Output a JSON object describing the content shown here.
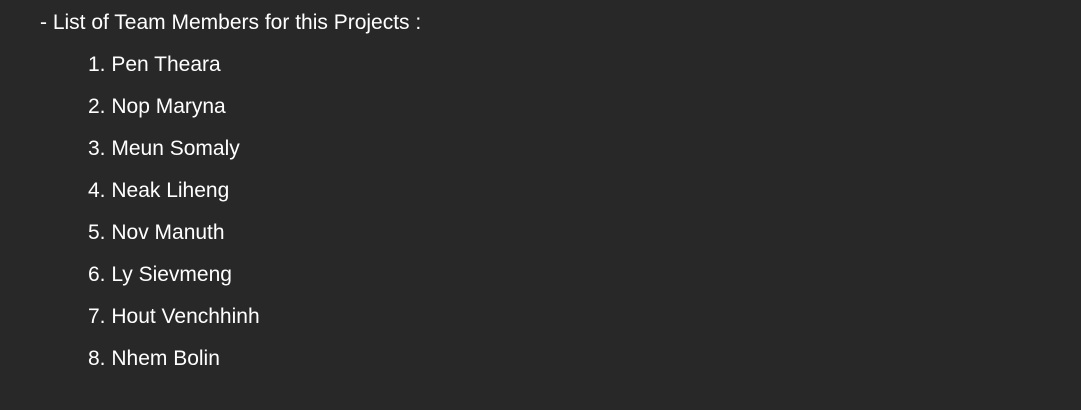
{
  "heading": "- List of Team Members for this Projects :",
  "members": [
    "1. Pen Theara",
    "2. Nop Maryna",
    "3. Meun Somaly",
    "4. Neak Liheng",
    "5. Nov Manuth",
    "6. Ly Sievmeng",
    "7. Hout Venchhinh",
    "8. Nhem Bolin"
  ],
  "colors": {
    "background": "#282828",
    "text": "#ffffff"
  }
}
